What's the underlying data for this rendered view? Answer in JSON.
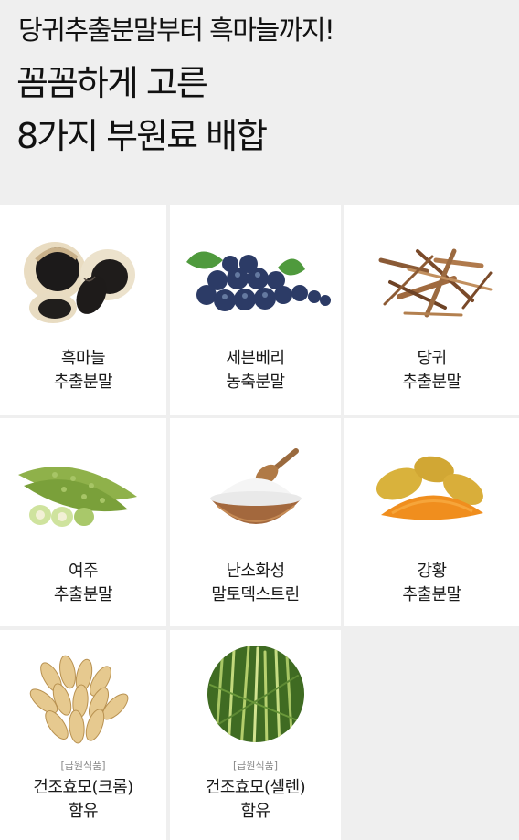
{
  "header": {
    "tagline": "당귀추출분말부터 흑마늘까지!",
    "headline_line1": "꼼꼼하게 고른",
    "headline_line2": "8가지 부원료 배합"
  },
  "ingredients": [
    {
      "name": "흑마늘",
      "form": "추출분말",
      "icon": "black-garlic-image"
    },
    {
      "name": "세븐베리",
      "form": "농축분말",
      "icon": "blueberries-image"
    },
    {
      "name": "당귀",
      "form": "추출분말",
      "icon": "angelica-root-image"
    },
    {
      "name": "여주",
      "form": "추출분말",
      "icon": "bitter-melon-image"
    },
    {
      "name": "난소화성",
      "form": "말토덱스트린",
      "icon": "powder-bowl-image"
    },
    {
      "name": "강황",
      "form": "추출분말",
      "icon": "turmeric-image"
    },
    {
      "tag": "[급원식품]",
      "name": "건조효모(크롬)",
      "form": "함유",
      "icon": "barley-grains-image"
    },
    {
      "tag": "[급원식품]",
      "name": "건조효모(셀렌)",
      "form": "함유",
      "icon": "barley-field-image"
    }
  ]
}
